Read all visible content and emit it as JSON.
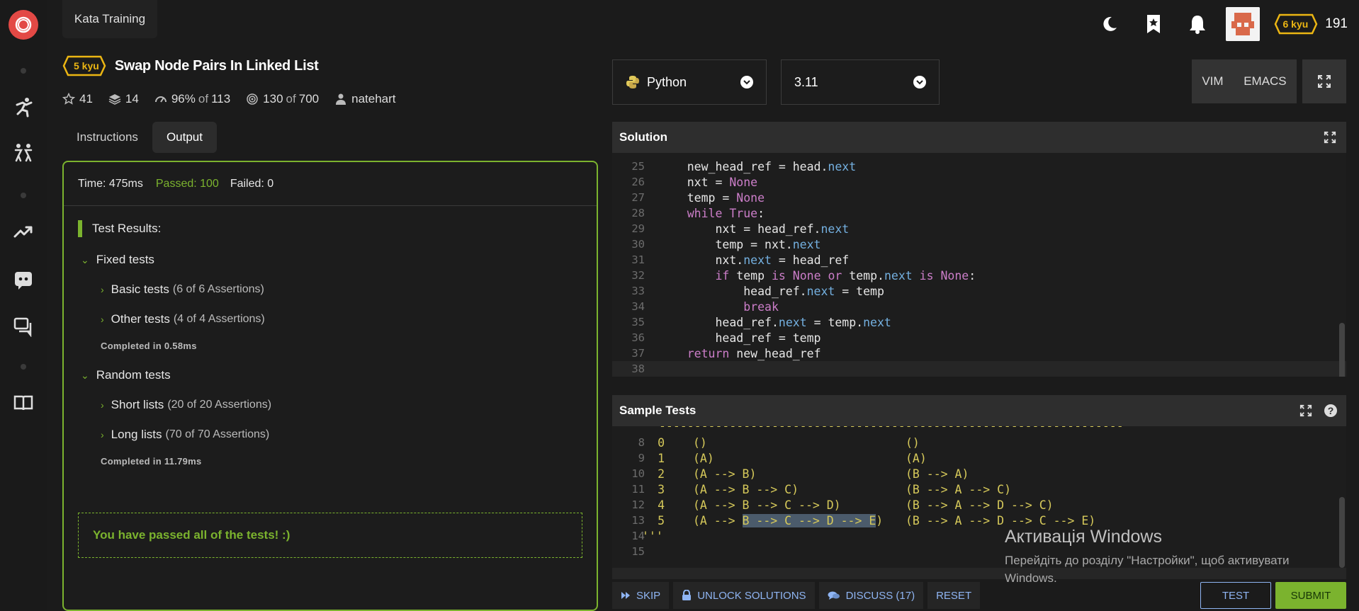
{
  "app": {
    "brand": "Kata Training",
    "honor": "191",
    "user_rank": "6 kyu"
  },
  "kata": {
    "rank": "5 kyu",
    "title": "Swap Node Pairs In Linked List",
    "stars": "41",
    "collections": "14",
    "satisfaction": "96%",
    "satisfaction_of": "of",
    "satisfaction_votes": "113",
    "completed": "130",
    "completed_of": "of",
    "completed_total": "700",
    "author": "natehart"
  },
  "tabs": {
    "instructions": "Instructions",
    "output": "Output"
  },
  "output": {
    "time": "Time: 475ms",
    "passed": "Passed: 100",
    "failed": "Failed: 0",
    "results_title": "Test Results:",
    "fixed_group": "Fixed tests",
    "basic": "Basic tests",
    "basic_assert": "(6 of 6 Assertions)",
    "other": "Other tests",
    "other_assert": "(4 of 4 Assertions)",
    "fixed_completed": "Completed in 0.58ms",
    "random_group": "Random tests",
    "short": "Short lists",
    "short_assert": "(20 of 20 Assertions)",
    "long": "Long lists",
    "long_assert": "(70 of 70 Assertions)",
    "random_completed": "Completed in 11.79ms",
    "passed_message": "You have passed all of the tests! :)"
  },
  "editor_controls": {
    "language": "Python",
    "version": "3.11",
    "vim": "VIM",
    "emacs": "EMACS"
  },
  "solution": {
    "title": "Solution",
    "lines": [
      "25",
      "26",
      "27",
      "28",
      "29",
      "30",
      "31",
      "32",
      "33",
      "34",
      "35",
      "36",
      "37",
      "38"
    ]
  },
  "sample": {
    "title": "Sample Tests",
    "lines": [
      "8",
      "9",
      "10",
      "11",
      "12",
      "13",
      "14",
      "15"
    ],
    "rows": [
      {
        "n": "0",
        "in": "()",
        "out": "()"
      },
      {
        "n": "1",
        "in": "(A)",
        "out": "(A)"
      },
      {
        "n": "2",
        "in": "(A --> B)",
        "out": "(B --> A)"
      },
      {
        "n": "3",
        "in": "(A --> B --> C)",
        "out": "(B --> A --> C)"
      },
      {
        "n": "4",
        "in": "(A --> B --> C --> D)",
        "out": "(B --> A --> D --> C)"
      },
      {
        "n": "5",
        "in": "(A --> ",
        "in_sel": "B --> C --> D --> E",
        "in_end": ")",
        "out": "(B --> A --> D --> C --> E)"
      }
    ],
    "triple_quote": "'''"
  },
  "actions": {
    "skip": "SKIP",
    "unlock": "UNLOCK SOLUTIONS",
    "discuss": "DISCUSS (17)",
    "reset": "RESET",
    "test": "TEST",
    "submit": "SUBMIT"
  },
  "watermark": {
    "title": "Активація Windows",
    "line1": "Перейдіть до розділу \"Настройки\", щоб активувати",
    "line2": "Windows."
  },
  "colors": {
    "accent_green": "#7bb32e",
    "kyu_yellow": "#ecb613",
    "brand_red": "#e34945",
    "link_blue": "#8fb5f3"
  }
}
